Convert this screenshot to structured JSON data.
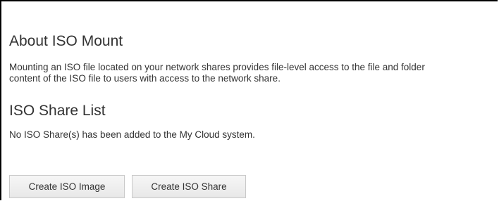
{
  "about": {
    "title": "About ISO Mount",
    "line1": "Mounting an ISO file located on your network shares provides file-level access to the file and folder",
    "line2": "content of the ISO file to users with access to the network share."
  },
  "share_list": {
    "title": "ISO Share List",
    "empty_message": "No ISO Share(s) has been added to the My Cloud system."
  },
  "actions": {
    "create_image_label": "Create ISO Image",
    "create_share_label": "Create ISO Share"
  }
}
